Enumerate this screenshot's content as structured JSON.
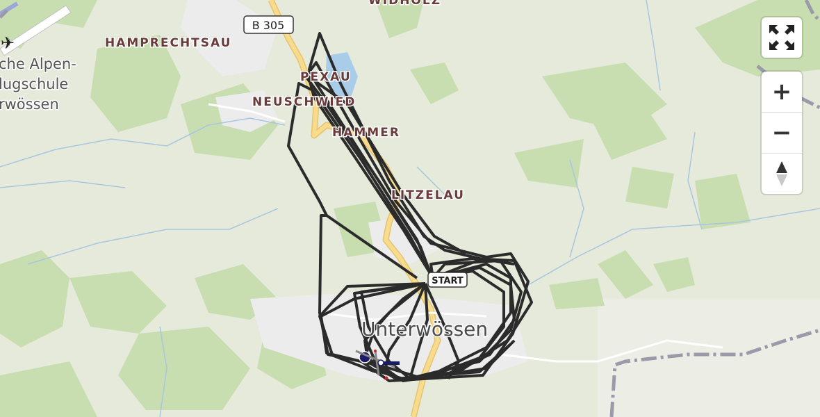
{
  "map": {
    "road_label": "B 305",
    "places": {
      "widholz": "WIDHOLZ",
      "hamprechtsau": "HAMPRECHTSAU",
      "pexau": "PEXAU",
      "neuschwied": "NEUSCHWIED",
      "hammer": "HAMMER",
      "litzelau": "LITZELAU"
    },
    "town": "Unterwössen",
    "airfield_lines": [
      "che Alpen-",
      "lugschule",
      "rwössen"
    ],
    "start_label": "START",
    "track_color": "#2b2b2b"
  },
  "controls": {
    "fullscreen_icon": "fullscreen-icon",
    "zoom_in": "+",
    "zoom_out": "−",
    "compass_icon": "north-arrow-icon"
  }
}
